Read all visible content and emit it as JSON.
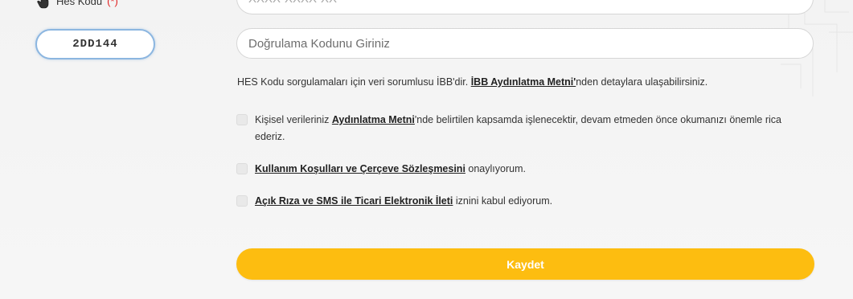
{
  "hes": {
    "label": "Hes Kodu",
    "required_mark": "(*)",
    "placeholder": "XXXX-XXXX-XX"
  },
  "captcha": {
    "code": "2DD144"
  },
  "verification": {
    "placeholder": "Doğrulama Kodunu Giriniz"
  },
  "info": {
    "text_before": "HES Kodu sorgulamaları için veri sorumlusu İBB'dir. ",
    "link": "İBB Aydınlatma Metni'",
    "text_after": "nden detaylara ulaşabilirsiniz."
  },
  "consents": [
    {
      "before": "Kişisel verileriniz ",
      "link": "Aydınlatma Metni",
      "after": "'nde belirtilen kapsamda işlenecektir, devam etmeden önce okumanızı önemle rica ederiz.",
      "checked": false
    },
    {
      "before": "",
      "link": "Kullanım Koşulları ve Çerçeve Sözleşmesini",
      "after": " onaylıyorum.",
      "checked": false
    },
    {
      "before": "",
      "link": "Açık Rıza ve SMS ile Ticari Elektronik İleti",
      "after": " iznini kabul ediyorum.",
      "checked": false
    }
  ],
  "submit": {
    "label": "Kaydet"
  },
  "colors": {
    "accent": "#fdbd10",
    "captcha_border": "#8cb6e0",
    "required": "#e02020"
  },
  "icons": {
    "hes_label": "hand-pointer-icon"
  }
}
